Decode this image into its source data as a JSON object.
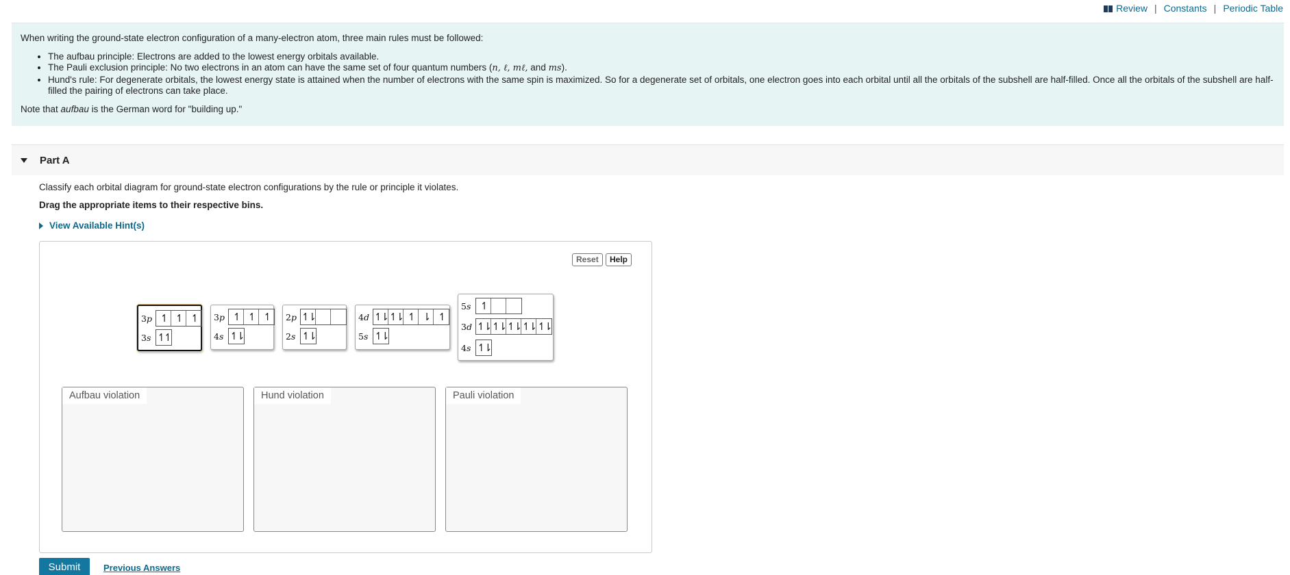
{
  "toplinks": {
    "review": "Review",
    "constants": "Constants",
    "periodic_table": "Periodic Table",
    "sep": "|"
  },
  "intro": {
    "lead": "When writing the ground-state electron configuration of a many-electron atom, three main rules must be followed:",
    "rule1": "The aufbau principle: Electrons are added to the lowest energy orbitals available.",
    "rule2_pre": "The Pauli exclusion principle:  No two electrons in an atom can have the same set of four quantum numbers (",
    "rule2_vars": "n, ℓ, mℓ,",
    "rule2_and": " and ",
    "rule2_ms": "ms",
    "rule2_post": ").",
    "rule3": "Hund's rule: For degenerate orbitals, the lowest energy state is attained when the number of electrons with the same spin is maximized. So for a degenerate set of orbitals, one electron goes into each orbital until all the orbitals of the subshell are half-filled. Once all the orbitals of the subshell are half-filled the pairing of electrons can take place.",
    "note_pre": "Note that ",
    "note_em": "aufbau",
    "note_post": " is the German word for \"building up.\""
  },
  "part": {
    "title": "Part A"
  },
  "instructions": "Classify each orbital diagram for ground-state electron configurations by the rule or principle it violates.",
  "drag_instructions": "Drag the appropriate items to their respective bins.",
  "hints_label": "View Available Hint(s)",
  "buttons": {
    "reset": "Reset",
    "help": "Help",
    "submit": "Submit",
    "previous_answers": "Previous Answers"
  },
  "cards": [
    {
      "rows": [
        {
          "n": "3",
          "l": "p",
          "boxes": [
            "↿",
            "↿",
            "↿"
          ]
        },
        {
          "n": "3",
          "l": "s",
          "boxes": [
            "↿↿"
          ]
        }
      ]
    },
    {
      "rows": [
        {
          "n": "3",
          "l": "p",
          "boxes": [
            "↿",
            "↿",
            "↿"
          ]
        },
        {
          "n": "4",
          "l": "s",
          "boxes": [
            "↿⇂"
          ]
        }
      ]
    },
    {
      "rows": [
        {
          "n": "2",
          "l": "p",
          "boxes": [
            "↿⇂",
            "",
            ""
          ]
        },
        {
          "n": "2",
          "l": "s",
          "boxes": [
            "↿⇂"
          ]
        }
      ]
    },
    {
      "rows": [
        {
          "n": "4",
          "l": "d",
          "boxes": [
            "↿⇂",
            "↿⇂",
            "↿",
            "⇂",
            "↿"
          ]
        },
        {
          "n": "5",
          "l": "s",
          "boxes": [
            "↿⇂"
          ]
        }
      ]
    },
    {
      "rows": [
        {
          "n": "5",
          "l": "s",
          "boxes": [
            "↿",
            "",
            ""
          ]
        },
        {
          "n": "3",
          "l": "d",
          "boxes": [
            "↿⇂",
            "↿⇂",
            "↿⇂",
            "↿⇂",
            "↿⇂"
          ]
        },
        {
          "n": "4",
          "l": "s",
          "boxes": [
            "↿⇂"
          ]
        }
      ]
    }
  ],
  "bins": [
    {
      "label": "Aufbau violation"
    },
    {
      "label": "Hund violation"
    },
    {
      "label": "Pauli violation"
    }
  ]
}
